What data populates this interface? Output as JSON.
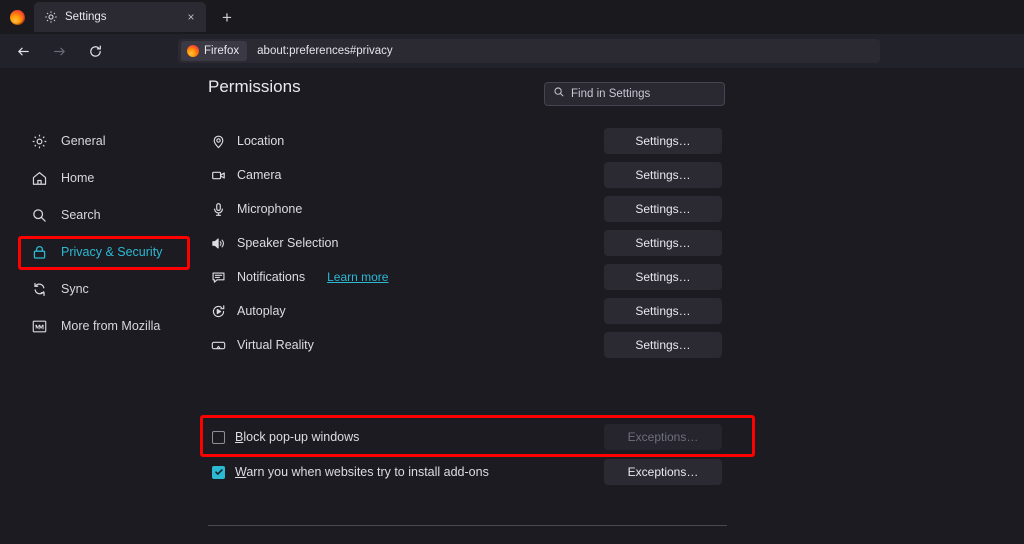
{
  "browser": {
    "brand_logo": "firefox-logo",
    "tab": {
      "title": "Settings",
      "icon": "gear-icon",
      "close_label": "×"
    },
    "new_tab_label": "+",
    "nav": {
      "back": "back-arrow-icon",
      "forward": "forward-arrow-icon",
      "reload": "reload-icon"
    },
    "urlbar": {
      "identity_chip": "Firefox",
      "url": "about:preferences#privacy"
    }
  },
  "search": {
    "placeholder": "Find in Settings",
    "icon": "search-icon"
  },
  "sidebar": {
    "items": [
      {
        "label": "General",
        "icon": "gear-icon",
        "active": false
      },
      {
        "label": "Home",
        "icon": "home-icon",
        "active": false
      },
      {
        "label": "Search",
        "icon": "search-icon",
        "active": false
      },
      {
        "label": "Privacy & Security",
        "icon": "lock-icon",
        "active": true
      },
      {
        "label": "Sync",
        "icon": "sync-icon",
        "active": false
      },
      {
        "label": "More from Mozilla",
        "icon": "mozilla-m-icon",
        "active": false
      }
    ]
  },
  "main": {
    "section_title": "Permissions",
    "permissions": [
      {
        "label": "Location",
        "icon": "location-pin-icon",
        "button": "Settings…"
      },
      {
        "label": "Camera",
        "icon": "camera-icon",
        "button": "Settings…"
      },
      {
        "label": "Microphone",
        "icon": "microphone-icon",
        "button": "Settings…"
      },
      {
        "label": "Speaker Selection",
        "icon": "speaker-icon",
        "button": "Settings…"
      },
      {
        "label": "Notifications",
        "icon": "notification-bubble-icon",
        "button": "Settings…",
        "link": "Learn more"
      },
      {
        "label": "Autoplay",
        "icon": "autoplay-icon",
        "button": "Settings…"
      },
      {
        "label": "Virtual Reality",
        "icon": "vr-headset-icon",
        "button": "Settings…"
      }
    ],
    "checkboxes": [
      {
        "label_accesskey": "B",
        "label_rest": "lock pop-up windows",
        "checked": false,
        "button": "Exceptions…",
        "button_disabled": true
      },
      {
        "label_accesskey": "W",
        "label_rest": "arn you when websites try to install add-ons",
        "checked": true,
        "button": "Exceptions…",
        "button_disabled": false
      }
    ]
  },
  "annotations": {
    "highlight_color": "#ff0000",
    "boxes": [
      {
        "name": "privacy-security-highlight"
      },
      {
        "name": "block-popups-highlight"
      }
    ]
  }
}
